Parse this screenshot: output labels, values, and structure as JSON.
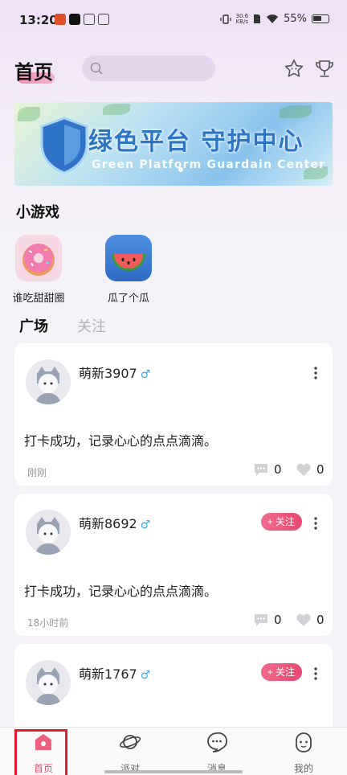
{
  "status_bar": {
    "time": "13:20",
    "network_speed_value": "30.6",
    "network_speed_unit": "KB/s",
    "battery": "55%"
  },
  "header": {
    "title": "首页",
    "search_placeholder": ""
  },
  "banner": {
    "title": "绿色平台 守护中心",
    "subtitle": "Green Platform Guardain Center"
  },
  "games": {
    "section_title": "小游戏",
    "items": [
      {
        "label": "谁吃甜甜圈",
        "icon": "donut-icon"
      },
      {
        "label": "瓜了个瓜",
        "icon": "watermelon-icon"
      }
    ]
  },
  "feed_tabs": [
    {
      "label": "广场",
      "active": true
    },
    {
      "label": "关注",
      "active": false
    }
  ],
  "posts": [
    {
      "username": "萌新3907",
      "gender_symbol": "♂",
      "text": "打卡成功，记录心心的点点滴滴。",
      "time": "刚刚",
      "comments": "0",
      "likes": "0",
      "follow_label": ""
    },
    {
      "username": "萌新8692",
      "gender_symbol": "♂",
      "text": "打卡成功，记录心心的点点滴滴。",
      "time": "18小时前",
      "comments": "0",
      "likes": "0",
      "follow_label": "+ 关注"
    },
    {
      "username": "萌新1767",
      "gender_symbol": "♂",
      "text": "",
      "time": "",
      "comments": "",
      "likes": "",
      "follow_label": "+ 关注"
    }
  ],
  "bottom_nav": [
    {
      "label": "首页",
      "icon": "home-icon",
      "active": true
    },
    {
      "label": "派对",
      "icon": "planet-icon",
      "active": false
    },
    {
      "label": "消息",
      "icon": "chat-bubble-icon",
      "active": false
    },
    {
      "label": "我的",
      "icon": "profile-face-icon",
      "active": false
    }
  ],
  "colors": {
    "accent": "#e8486f",
    "highlight_box": "#e41b2a",
    "gender_male": "#3aa9e6"
  }
}
